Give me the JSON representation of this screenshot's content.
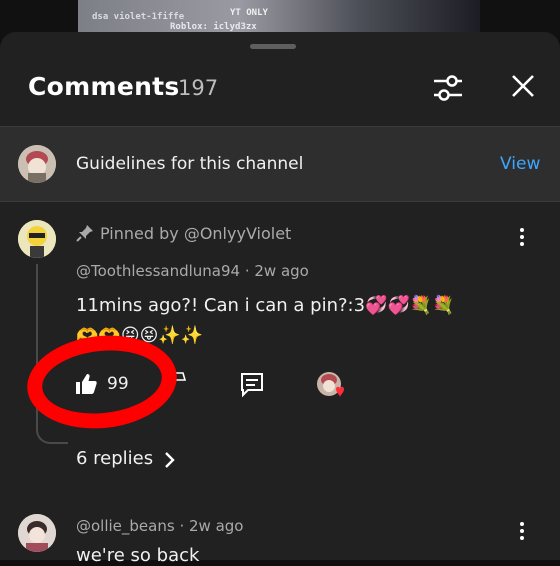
{
  "video": {
    "channel_tag": "dsa violet-1fiffe",
    "roblox_tag": "Roblox: iclyd3zx",
    "overlay_tag": "YT ONLY"
  },
  "header": {
    "title": "Comments",
    "count": "197"
  },
  "guidelines": {
    "text": "Guidelines for this channel",
    "action": "View"
  },
  "comments": [
    {
      "pinned_label": "Pinned by @OnlyyViolet",
      "author": "@Toothlessandluna94",
      "time": "2w ago",
      "text": "11mins ago?! Can i can a pin?:3💞💞💐💐",
      "emoji_line": "🫶🫶😝😝✨✨",
      "likes": "99",
      "replies": "6 replies"
    },
    {
      "author": "@ollie_beans",
      "time": "2w ago",
      "text": "we're so back"
    }
  ],
  "colors": {
    "accent": "#3ea6ff",
    "annotation": "#ff0000",
    "sheet": "#212121"
  },
  "icons": {
    "filter": "sliders-icon",
    "close": "close-icon",
    "pin": "pin-icon",
    "like": "thumbs-up-icon",
    "reply": "reply-icon",
    "more": "more-vert-icon",
    "chevron": "chevron-right-icon"
  }
}
